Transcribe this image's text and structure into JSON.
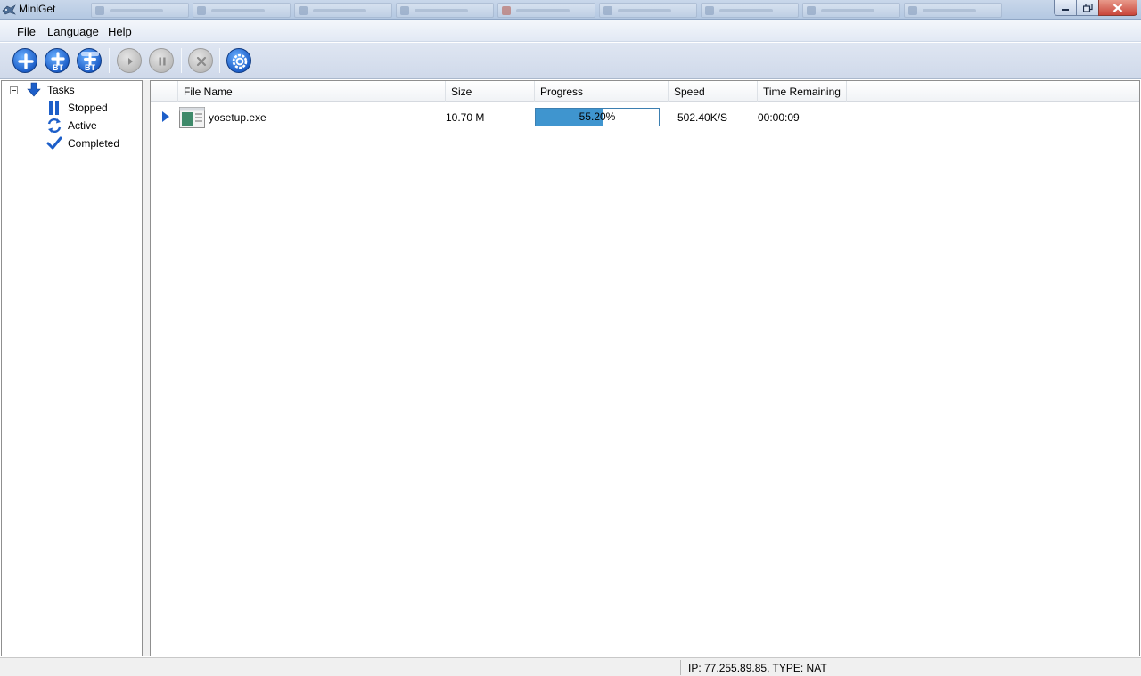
{
  "window": {
    "title": "MiniGet"
  },
  "menu": {
    "items": [
      "File",
      "Language",
      "Help"
    ]
  },
  "toolbar": {
    "bt_label": "BT"
  },
  "tree": {
    "root": "Tasks",
    "children": [
      "Stopped",
      "Active",
      "Completed"
    ]
  },
  "list": {
    "columns": [
      "File Name",
      "Size",
      "Progress",
      "Speed",
      "Time Remaining"
    ],
    "rows": [
      {
        "file_name": "yosetup.exe",
        "size": "10.70 M",
        "progress_text": "55.20%",
        "progress_value": 55.2,
        "speed": "502.40K/S",
        "time_remaining": "00:00:09"
      }
    ]
  },
  "status": {
    "text": "IP: 77.255.89.85, TYPE: NAT"
  },
  "colors": {
    "accent": "#1d5fc9",
    "progress_fill": "#3f95cf"
  }
}
